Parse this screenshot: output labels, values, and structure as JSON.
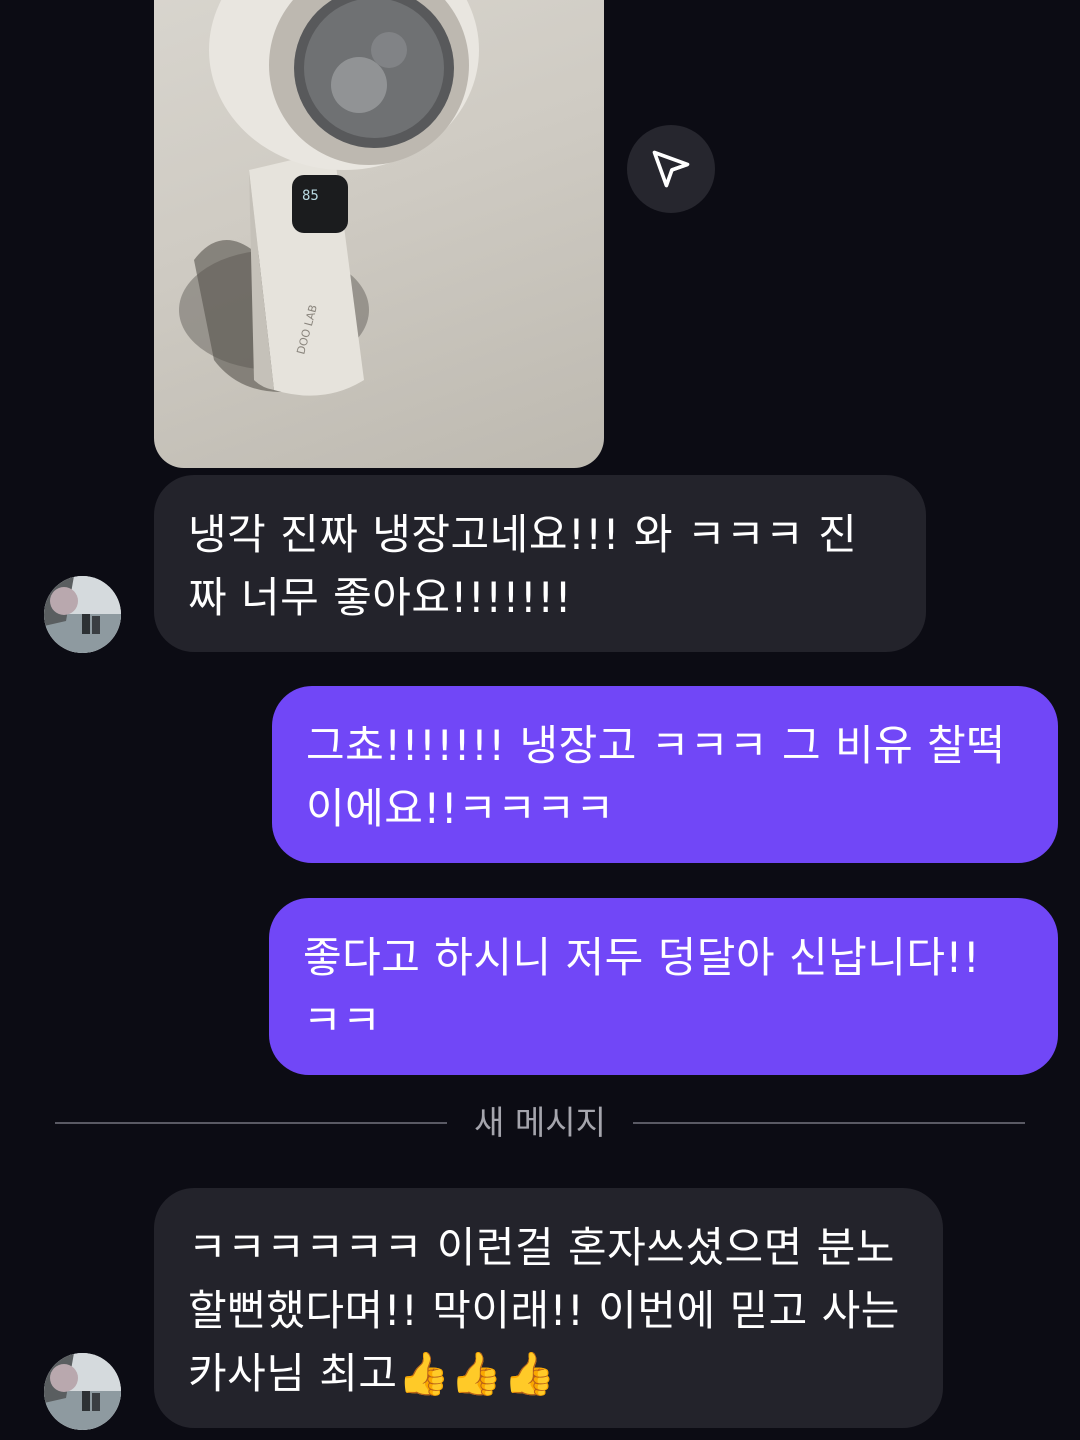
{
  "messages": [
    {
      "sender": "other",
      "type": "image"
    },
    {
      "sender": "other",
      "text": "냉각 진짜 냉장고네요!!! 와 ㅋㅋㅋ 진짜 너무 좋아요!!!!!!!"
    },
    {
      "sender": "me",
      "text": "그쵸!!!!!!! 냉장고 ㅋㅋㅋ 그 비유 찰떡이에요!!ㅋㅋㅋㅋ"
    },
    {
      "sender": "me",
      "text": "좋다고 하시니 저두 덩달아 신납니다!! ㅋㅋ"
    },
    {
      "sender": "other",
      "text": "ㅋㅋㅋㅋㅋㅋ 이런걸 혼자쓰셨으면 분노할뻔했다며!! 막이래!! 이번에 믿고 사는카사님 최고👍👍👍"
    }
  ],
  "divider": {
    "label": "새 메시지"
  },
  "photo": {
    "device_display": "85",
    "brand_text": "DOO LAB"
  },
  "icons": {
    "share": "send-icon",
    "avatar": "avatar-photo"
  },
  "colors": {
    "background": "#0c0c14",
    "incoming_bubble": "#23232b",
    "outgoing_bubble": "#7147f7"
  }
}
